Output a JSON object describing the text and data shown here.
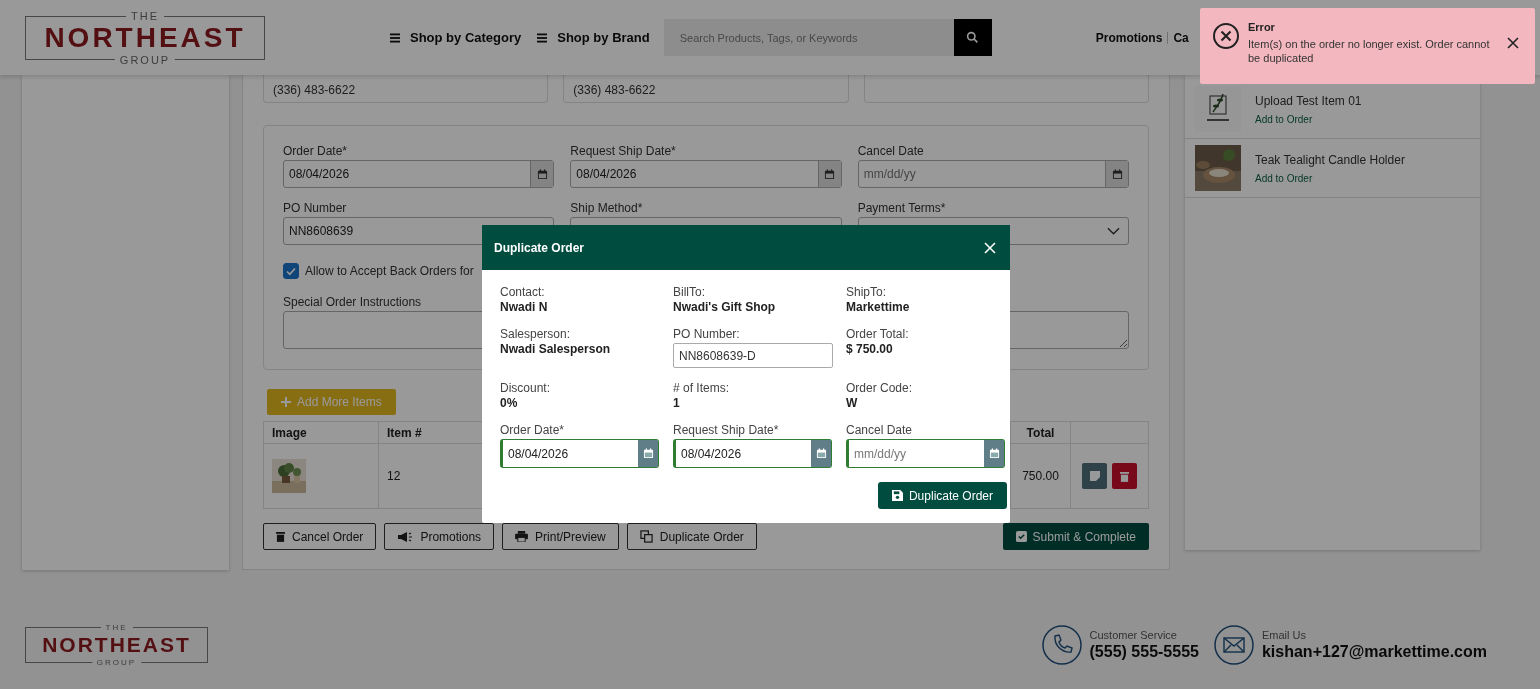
{
  "header": {
    "logo": {
      "top": "THE",
      "main": "NORTHEAST",
      "bottom": "GROUP"
    },
    "nav": [
      "Shop by Category",
      "Shop by Brand"
    ],
    "search": {
      "placeholder": "Search Products, Tags, or Keywords"
    },
    "links": [
      "Promotions",
      "Ca"
    ]
  },
  "address_cards": [
    "(336) 483-6622",
    "(336) 483-6622"
  ],
  "order_form": {
    "fields": [
      {
        "label": "Order Date*",
        "value": "08/04/2026",
        "kind": "date"
      },
      {
        "label": "Request Ship Date*",
        "value": "08/04/2026",
        "kind": "date"
      },
      {
        "label": "Cancel Date",
        "placeholder": "mm/dd/yy",
        "kind": "date"
      },
      {
        "label": "PO Number",
        "value": "NN8608639",
        "kind": "text"
      },
      {
        "label": "Ship Method*",
        "kind": "select"
      },
      {
        "label": "Payment Terms*",
        "kind": "select"
      }
    ],
    "back_orders": {
      "label": "Allow to Accept Back Orders for",
      "checked": true
    },
    "instructions": {
      "label": "Special Order Instructions"
    }
  },
  "add_items_button": "Add More Items",
  "table": {
    "columns": [
      "Image",
      "Item #",
      "Total"
    ],
    "rows": [
      {
        "item": "12",
        "total": "750.00"
      }
    ]
  },
  "actions": [
    {
      "label": "Cancel Order",
      "kind": "cancel"
    },
    {
      "label": "Promotions",
      "kind": "promotions"
    },
    {
      "label": "Print/Preview",
      "kind": "print"
    },
    {
      "label": "Duplicate Order",
      "kind": "duplicate"
    }
  ],
  "submit_button": "Submit & Complete",
  "sidebar": {
    "items": [
      {
        "name": "Upload Test Item 01",
        "action": "Add to Order"
      },
      {
        "name": "Teak Tealight Candle Holder",
        "action": "Add to Order"
      }
    ]
  },
  "footer": {
    "logo": {
      "top": "THE",
      "main": "NORTHEAST",
      "bottom": "GROUP"
    },
    "contacts": [
      {
        "kind": "phone",
        "label": "Customer Service",
        "value": "(555) 555-5555"
      },
      {
        "kind": "email",
        "label": "Email Us",
        "value": "kishan+127@markettime.com"
      }
    ]
  },
  "modal": {
    "title": "Duplicate Order",
    "info": [
      {
        "label": "Contact:",
        "value": "Nwadi N",
        "kind": "text"
      },
      {
        "label": "BillTo:",
        "value": "Nwadi's Gift Shop",
        "kind": "text"
      },
      {
        "label": "ShipTo:",
        "value": "Markettime",
        "kind": "text"
      },
      {
        "label": "Salesperson:",
        "value": "Nwadi Salesperson",
        "kind": "text"
      },
      {
        "label": "PO Number:",
        "value": "NN8608639-D",
        "kind": "input"
      },
      {
        "label": "Order Total:",
        "value": "$ 750.00",
        "kind": "text"
      },
      {
        "label": "Discount:",
        "value": "0%",
        "kind": "text"
      },
      {
        "label": "# of Items:",
        "value": "1",
        "kind": "text"
      },
      {
        "label": "Order Code:",
        "value": "W",
        "kind": "text"
      }
    ],
    "dates": [
      {
        "label": "Order Date*",
        "value": "08/04/2026"
      },
      {
        "label": "Request Ship Date*",
        "value": "08/04/2026"
      },
      {
        "label": "Cancel Date",
        "placeholder": "mm/dd/yy"
      }
    ],
    "button": "Duplicate Order"
  },
  "toast": {
    "title": "Error",
    "message": "Item(s) on the order no longer exist. Order cannot be duplicated"
  }
}
